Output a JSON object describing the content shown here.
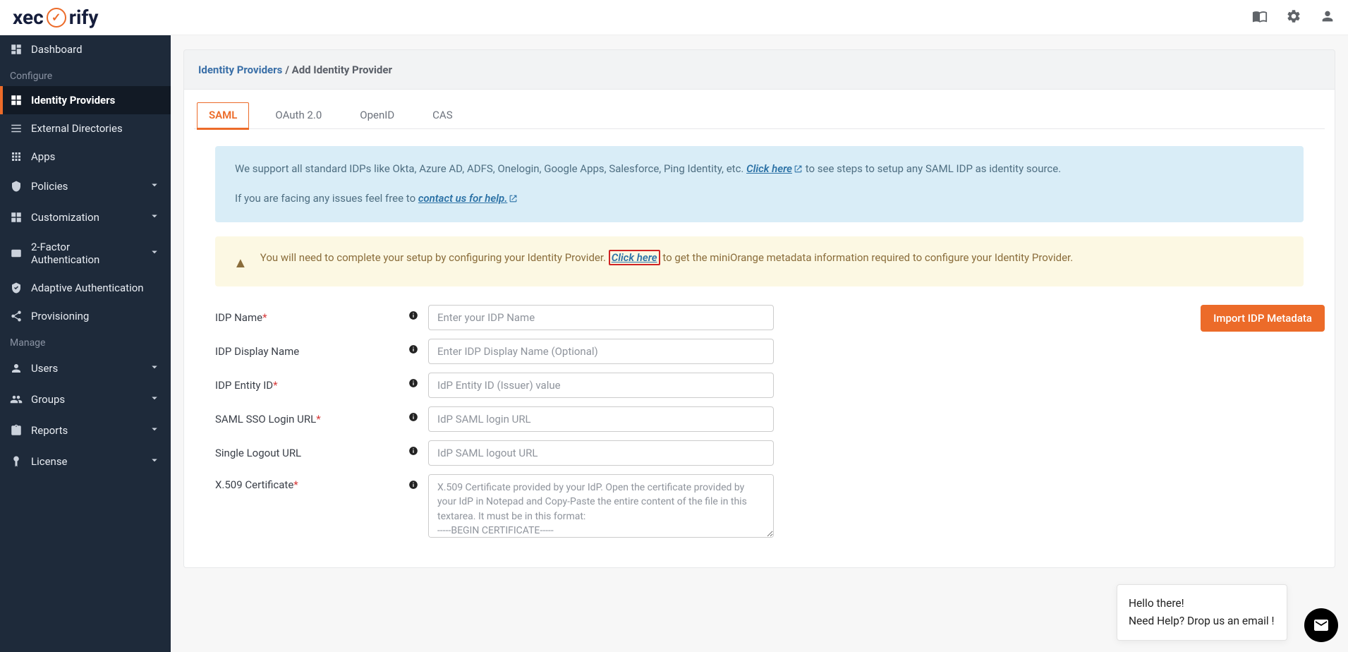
{
  "topbar": {
    "logo_pre": "xec",
    "logo_post": "rify"
  },
  "sidebar": {
    "section_configure": "Configure",
    "section_manage": "Manage",
    "items": {
      "dashboard": "Dashboard",
      "identity_providers": "Identity Providers",
      "external_directories": "External Directories",
      "apps": "Apps",
      "policies": "Policies",
      "customization": "Customization",
      "twofa": "2-Factor Authentication",
      "adaptive": "Adaptive Authentication",
      "provisioning": "Provisioning",
      "users": "Users",
      "groups": "Groups",
      "reports": "Reports",
      "license": "License"
    }
  },
  "breadcrumb": {
    "link": "Identity Providers",
    "current": "Add Identity Provider"
  },
  "tabs": {
    "saml": "SAML",
    "oauth": "OAuth 2.0",
    "openid": "OpenID",
    "cas": "CAS"
  },
  "info": {
    "text1": "We support all standard IDPs like Okta, Azure AD, ADFS, Onelogin, Google Apps, Salesforce, Ping Identity, etc. ",
    "click_here": "Click here",
    "text2": " to see steps to setup any SAML IDP as identity source.",
    "facing": "If you are facing any issues feel free to ",
    "contact": "contact us for help."
  },
  "warn": {
    "text1": "You will need to complete your setup by configuring your Identity Provider. ",
    "click_here": "Click here",
    "text2": " to get the miniOrange metadata information required to configure your Identity Provider."
  },
  "form": {
    "labels": {
      "idp_name": "IDP Name",
      "idp_display": "IDP Display Name",
      "idp_entity": "IDP Entity ID",
      "saml_sso": "SAML SSO Login URL",
      "slo": "Single Logout URL",
      "cert": "X.509 Certificate"
    },
    "placeholders": {
      "idp_name": "Enter your IDP Name",
      "idp_display": "Enter IDP Display Name (Optional)",
      "idp_entity": "IdP Entity ID (Issuer) value",
      "saml_sso": "IdP SAML login URL",
      "slo": "IdP SAML logout URL",
      "cert": "X.509 Certificate provided by your IdP. Open the certificate provided by your IdP in Notepad and Copy-Paste the entire content of the file in this textarea. It must be in this format:\n-----BEGIN CERTIFICATE-----"
    },
    "import_btn": "Import IDP Metadata"
  },
  "help": {
    "hello": "Hello there!",
    "need": "Need Help? Drop us an email !"
  }
}
